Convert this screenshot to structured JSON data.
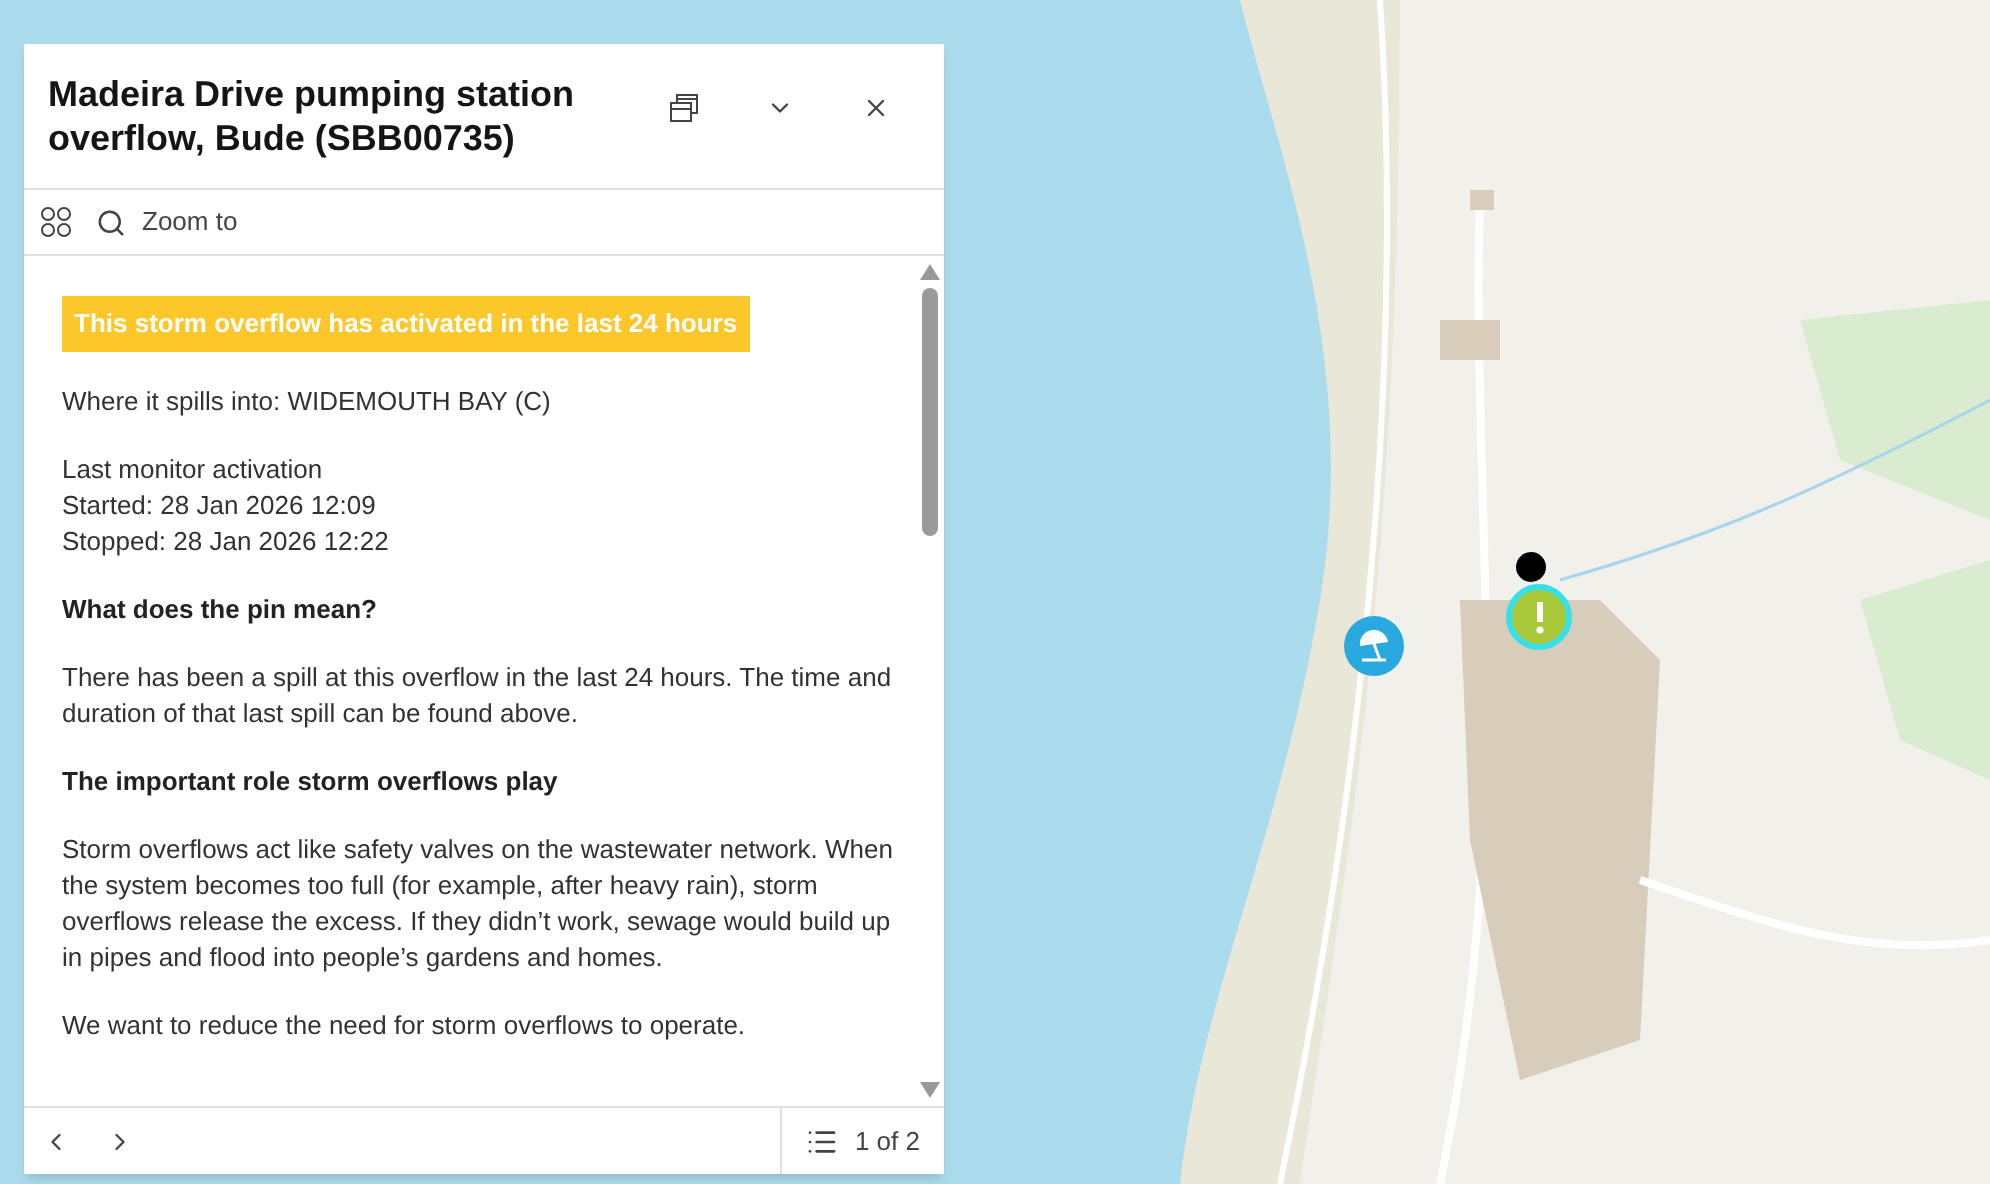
{
  "popup": {
    "title": "Madeira Drive pumping station overflow, Bude (SBB00735)",
    "toolbar": [
      {
        "kind": "grid"
      },
      {
        "kind": "zoom",
        "label": "Zoom to"
      }
    ],
    "content": [
      {
        "kind": "highlight",
        "lines": [
          "This storm overflow has activated in the last 24 hours"
        ]
      },
      {
        "kind": "paragraph",
        "lines": [
          "Where it spills into: WIDEMOUTH BAY (C)"
        ]
      },
      {
        "kind": "paragraph",
        "lines": [
          "Last monitor activation",
          "Started: 28 Jan 2026 12:09",
          "Stopped: 28 Jan 2026 12:22"
        ]
      },
      {
        "kind": "heading",
        "lines": [
          "What does the pin mean?"
        ]
      },
      {
        "kind": "paragraph",
        "lines": [
          "There has been a spill at this overflow in the last 24 hours. The time and duration of that last spill can be found above."
        ]
      },
      {
        "kind": "heading",
        "lines": [
          "The important role storm overflows play"
        ]
      },
      {
        "kind": "paragraph",
        "lines": [
          "Storm overflows act like safety valves on the wastewater network. When the system becomes too full (for example, after heavy rain), storm overflows release the excess. If they didn’t work, sewage would build up in pipes and flood into people’s gardens and homes."
        ]
      },
      {
        "kind": "paragraph",
        "lines": [
          "We want to reduce the need for storm overflows to operate."
        ]
      }
    ],
    "pagination": "1 of 2"
  },
  "pins": [
    {
      "kind": "dot"
    },
    {
      "kind": "alert"
    },
    {
      "kind": "beach"
    }
  ]
}
